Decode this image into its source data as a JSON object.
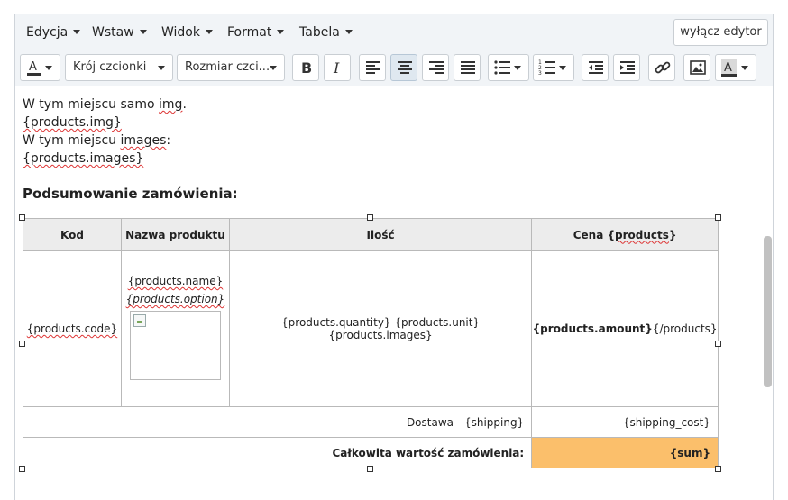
{
  "menubar": {
    "items": [
      "Edycja",
      "Wstaw",
      "Widok",
      "Format",
      "Tabela"
    ],
    "toggle_label": "wyłącz edytor"
  },
  "toolbar": {
    "font_family_label": "Krój czcionki",
    "font_size_label": "Rozmiar czci...",
    "icons": [
      "text-color-icon",
      "bold-icon",
      "italic-icon",
      "align-left-icon",
      "align-center-icon",
      "align-right-icon",
      "align-justify-icon",
      "bullet-list-icon",
      "numbered-list-icon",
      "outdent-icon",
      "indent-icon",
      "link-icon",
      "image-icon",
      "background-color-icon"
    ],
    "active": "align-center"
  },
  "content": {
    "line1_pre": " W tym miejscu samo ",
    "line1_word": "img",
    "line1_post": ".",
    "line2": "{products.img}",
    "line3_pre": "W tym miejscu ",
    "line3_word": "images",
    "line3_post": ":",
    "line4": "{products.images}",
    "heading": "Podsumowanie zamówienia:"
  },
  "table": {
    "headers": {
      "code": "Kod",
      "name": "Nazwa produktu",
      "qty": "Ilość",
      "price_pre": "Cena {",
      "price_word": "products",
      "price_post": "}"
    },
    "row": {
      "code": "{products.code}",
      "name": "{products.name}",
      "option": "{products.option}",
      "qty": "{products.quantity} {products.unit} {products.images}",
      "amount": "{products.amount}",
      "close": "{/products}"
    },
    "shipping_label": "Dostawa - {shipping}",
    "shipping_cost": "{shipping_cost}",
    "total_label": "Całkowita wartość zamówienia:",
    "total_value": "{sum}"
  },
  "colors": {
    "sum_background": "#fbbf6b",
    "toolbar_background": "#f1f4f7",
    "header_background": "#ececec"
  }
}
